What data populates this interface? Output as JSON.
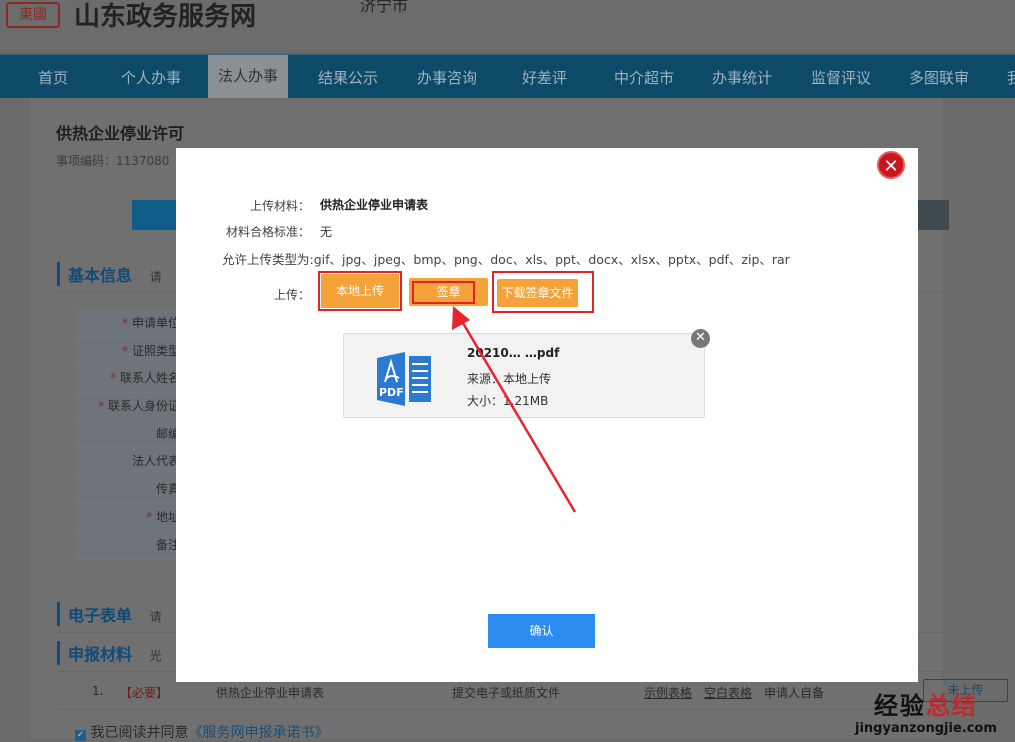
{
  "header": {
    "site_title": "山东政务服务网",
    "city": "济宁市",
    "logo_text": "東國"
  },
  "nav": {
    "items": [
      "首页",
      "个人办事",
      "法人办事",
      "结果公示",
      "办事咨询",
      "好差评",
      "中介超市",
      "办事统计",
      "监督评议",
      "多图联审",
      "我"
    ],
    "active": "法人办事"
  },
  "page": {
    "title": "供热企业停业许可",
    "code_label": "事项编码：1137080"
  },
  "sections": {
    "basic": "基本信息",
    "basic_hint": "请",
    "eform": "电子表单",
    "eform_hint": "请",
    "materials": "申报材料",
    "materials_hint": "光"
  },
  "form_labels": [
    {
      "label": "申请单位",
      "required": true
    },
    {
      "label": "证照类型",
      "required": true
    },
    {
      "label": "联系人姓名",
      "required": true
    },
    {
      "label": "联系人身份证",
      "required": true
    },
    {
      "label": "邮编",
      "required": false
    },
    {
      "label": "法人代表",
      "required": false
    },
    {
      "label": "传真",
      "required": false
    },
    {
      "label": "地址",
      "required": true
    },
    {
      "label": "备注",
      "required": false
    }
  ],
  "material_row": {
    "index": "1.",
    "tag": "【必要】",
    "name": "供热企业停业申请表",
    "type": "提交电子或纸质文件",
    "example": "示例表格",
    "blank": "空白表格",
    "source": "申请人自备",
    "upload": "未上传"
  },
  "agreement": {
    "text": "我已阅读并同意",
    "link": "《服务网申报承诺书》",
    "checked": true
  },
  "modal": {
    "material_label": "上传材料：",
    "material_value": "供热企业停业申请表",
    "standard_label": "材料合格标准：",
    "standard_value": "无",
    "types_label": "允许上传类型为:",
    "types_value": "gif、jpg、jpeg、bmp、png、doc、xls、ppt、docx、xlsx、pptx、pdf、zip、rar",
    "upload_label": "上传：",
    "buttons": {
      "local": "本地上传",
      "sign": "签章",
      "download": "下载签章文件"
    },
    "file": {
      "name": "20210…  …pdf",
      "source_label": "来源：",
      "source": "本地上传",
      "size_label": "大小：",
      "size": "1.21MB",
      "icon_text": "PDF"
    },
    "confirm": "确认"
  },
  "watermark": {
    "cn1": "经验",
    "cn2": "总结",
    "url": "jingyanzongjie.com"
  }
}
